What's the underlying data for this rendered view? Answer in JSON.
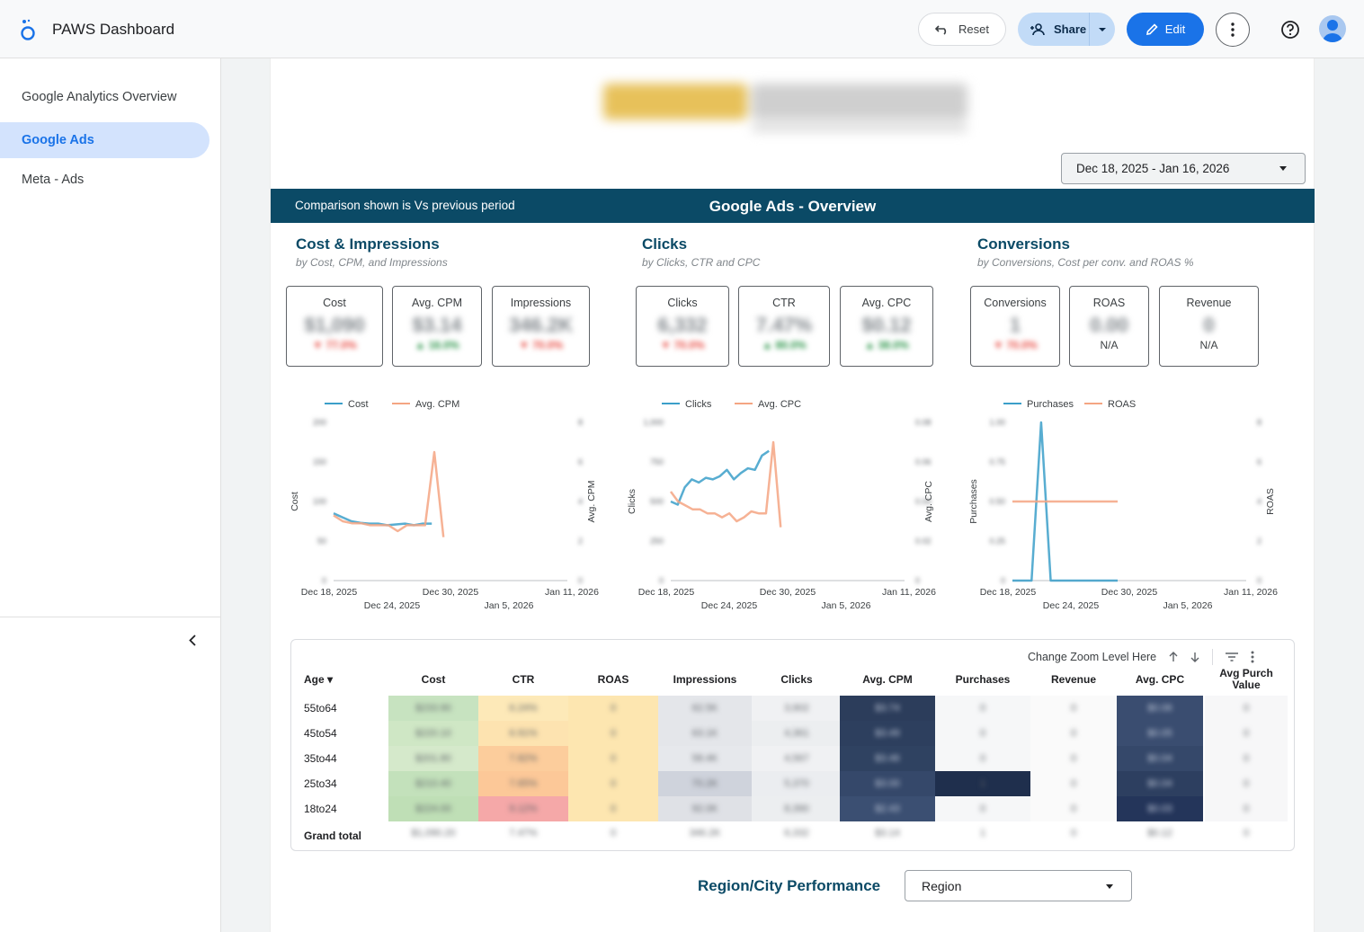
{
  "header": {
    "app_title": "PAWS Dashboard",
    "reset_label": "Reset",
    "share_label": "Share",
    "edit_label": "Edit"
  },
  "sidebar": {
    "items": [
      {
        "label": "Google Analytics Overview",
        "active": false
      },
      {
        "label": "Google Ads",
        "active": true
      },
      {
        "label": "Meta - Ads",
        "active": false
      }
    ]
  },
  "report": {
    "date_range": "Dec 18, 2025 - Jan 16, 2026",
    "banner_note": "Comparison shown is Vs previous period",
    "banner_title": "Google Ads - Overview",
    "sections": [
      {
        "title": "Cost & Impressions",
        "subtitle": "by Cost, CPM, and Impressions"
      },
      {
        "title": "Clicks",
        "subtitle": "by Clicks, CTR and CPC"
      },
      {
        "title": "Conversions",
        "subtitle": "by Conversions, Cost per conv. and ROAS %"
      }
    ],
    "kpis": [
      {
        "label": "Cost",
        "value": "$1,090",
        "delta": "▼ 77.0%",
        "tone": "up-bad"
      },
      {
        "label": "Avg. CPM",
        "value": "$3.14",
        "delta": "▲ 16.0%",
        "tone": "up-good"
      },
      {
        "label": "Impressions",
        "value": "346.2K",
        "delta": "▼ 70.0%",
        "tone": "up-bad"
      },
      {
        "label": "Clicks",
        "value": "6,332",
        "delta": "▼ 70.0%",
        "tone": "up-bad"
      },
      {
        "label": "CTR",
        "value": "7.47%",
        "delta": "▲ 80.0%",
        "tone": "up-good"
      },
      {
        "label": "Avg. CPC",
        "value": "$0.12",
        "delta": "▲ 38.0%",
        "tone": "up-good"
      },
      {
        "label": "Conversions",
        "value": "1",
        "delta": "▼ 70.0%",
        "tone": "up-bad"
      },
      {
        "label": "ROAS",
        "value": "0.00",
        "na": "N/A"
      },
      {
        "label": "Revenue",
        "value": "0",
        "na": "N/A"
      }
    ],
    "region_title": "Region/City Performance",
    "region_select": "Region"
  },
  "colors": {
    "series_primary": "#3b9fc9",
    "series_secondary": "#f4a582",
    "accent": "#1a73e8",
    "banner": "#0b4a66"
  },
  "chart_data": [
    {
      "type": "line",
      "legend": [
        "Cost",
        "Avg. CPM"
      ],
      "ylabel": "Cost",
      "y2label": "Avg. CPM",
      "y_ticks": [
        "200",
        "150",
        "100",
        "50",
        "0"
      ],
      "y2_ticks": [
        "8",
        "6",
        "4",
        "2",
        "0"
      ],
      "x_ticks_top": [
        "Dec 18, 2025",
        "Dec 30, 2025",
        "Jan 11, 2026"
      ],
      "x_ticks_bottom": [
        "Dec 24, 2025",
        "Jan 5, 2026"
      ],
      "series": [
        {
          "name": "Cost",
          "values": [
            85,
            80,
            75,
            73,
            72,
            72,
            70,
            71,
            72,
            70,
            72,
            72
          ]
        },
        {
          "name": "Avg. CPM",
          "values": [
            3.3,
            3.0,
            2.9,
            2.9,
            2.8,
            2.8,
            2.8,
            2.5,
            2.8,
            2.8,
            2.8,
            6.5,
            2.2
          ]
        }
      ]
    },
    {
      "type": "line",
      "legend": [
        "Clicks",
        "Avg. CPC"
      ],
      "ylabel": "Clicks",
      "y2label": "Avg. CPC",
      "y_ticks": [
        "1,000",
        "750",
        "500",
        "250",
        "0"
      ],
      "y2_ticks": [
        "0.08",
        "0.06",
        "0.04",
        "0.02",
        "0"
      ],
      "x_ticks_top": [
        "Dec 18, 2025",
        "Dec 30, 2025",
        "Jan 11, 2026"
      ],
      "x_ticks_bottom": [
        "Dec 24, 2025",
        "Jan 5, 2026"
      ],
      "series": [
        {
          "name": "Clicks",
          "values": [
            500,
            480,
            590,
            640,
            620,
            650,
            640,
            660,
            700,
            640,
            680,
            710,
            700,
            790,
            820
          ]
        },
        {
          "name": "Avg. CPC",
          "values": [
            0.045,
            0.04,
            0.038,
            0.036,
            0.036,
            0.034,
            0.034,
            0.032,
            0.034,
            0.03,
            0.032,
            0.035,
            0.034,
            0.034,
            0.07,
            0.027
          ]
        }
      ]
    },
    {
      "type": "line",
      "legend": [
        "Purchases",
        "ROAS"
      ],
      "ylabel": "Purchases",
      "y2label": "ROAS",
      "y_ticks": [
        "1.00",
        "0.75",
        "0.50",
        "0.25",
        "0"
      ],
      "y2_ticks": [
        "8",
        "6",
        "4",
        "2",
        "0"
      ],
      "x_ticks_top": [
        "Dec 18, 2025",
        "Dec 30, 2025",
        "Jan 11, 2026"
      ],
      "x_ticks_bottom": [
        "Dec 24, 2025",
        "Jan 5, 2026"
      ],
      "series": [
        {
          "name": "Purchases",
          "values": [
            0,
            0,
            0,
            1,
            0,
            0,
            0,
            0,
            0,
            0,
            0,
            0
          ]
        },
        {
          "name": "ROAS",
          "values": [
            4,
            4,
            4,
            4,
            4,
            4,
            4,
            4,
            4,
            4,
            4,
            4
          ]
        }
      ]
    }
  ],
  "table": {
    "tools_label": "Change Zoom Level Here",
    "headers": [
      "Age",
      "Cost",
      "CTR",
      "ROAS",
      "Impressions",
      "Clicks",
      "Avg. CPM",
      "Purchases",
      "Revenue",
      "Avg. CPC",
      "Avg Purch Value"
    ],
    "rows": [
      {
        "label": "55to64",
        "cells": [
          "$233.90",
          "6.24%",
          "0",
          "62.5K",
          "3,902",
          "$3.74",
          "0",
          "0",
          "$0.06",
          "0"
        ]
      },
      {
        "label": "45to54",
        "cells": [
          "$220.10",
          "6.91%",
          "0",
          "63.1K",
          "4,361",
          "$3.49",
          "0",
          "0",
          "$0.05",
          "0"
        ]
      },
      {
        "label": "35to44",
        "cells": [
          "$201.80",
          "7.82%",
          "0",
          "58.4K",
          "4,567",
          "$3.46",
          "0",
          "0",
          "$0.04",
          "0"
        ]
      },
      {
        "label": "25to34",
        "cells": [
          "$210.40",
          "7.65%",
          "0",
          "70.2K",
          "5,370",
          "$3.00",
          "1",
          "0",
          "$0.04",
          "0"
        ]
      },
      {
        "label": "18to24",
        "cells": [
          "$224.00",
          "9.12%",
          "0",
          "92.0K",
          "8,390",
          "$2.43",
          "0",
          "0",
          "$0.03",
          "0"
        ]
      }
    ],
    "total": {
      "label": "Grand total",
      "cells": [
        "$1,090.20",
        "7.47%",
        "0",
        "346.2K",
        "6,332",
        "$3.14",
        "1",
        "0",
        "$0.12",
        "0"
      ]
    }
  }
}
